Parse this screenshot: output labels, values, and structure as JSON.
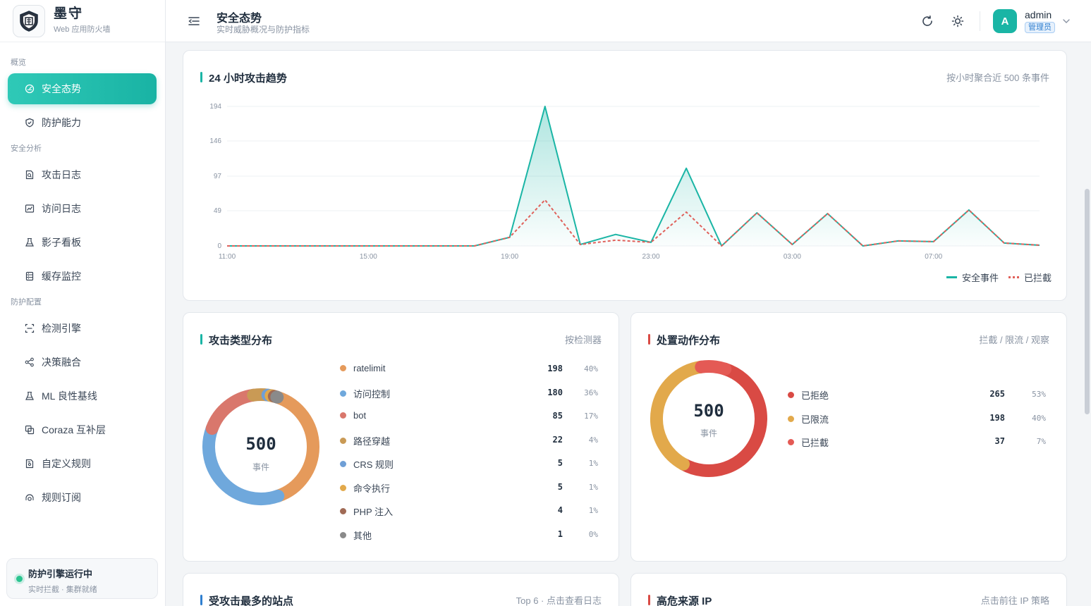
{
  "brand": {
    "title": "墨守",
    "subtitle": "Web 应用防火墙"
  },
  "sidebar": {
    "groups": [
      {
        "label": "概览",
        "items": [
          {
            "label": "安全态势",
            "icon": "dashboard-icon",
            "active": true
          },
          {
            "label": "防护能力",
            "icon": "shield-icon"
          }
        ]
      },
      {
        "label": "安全分析",
        "items": [
          {
            "label": "攻击日志",
            "icon": "file-search-icon"
          },
          {
            "label": "访问日志",
            "icon": "line-chart-icon"
          },
          {
            "label": "影子看板",
            "icon": "flask-icon"
          },
          {
            "label": "缓存监控",
            "icon": "database-icon"
          }
        ]
      },
      {
        "label": "防护配置",
        "items": [
          {
            "label": "检测引擎",
            "icon": "scan-icon"
          },
          {
            "label": "决策融合",
            "icon": "share-nodes-icon"
          },
          {
            "label": "ML 良性基线",
            "icon": "flask-icon"
          },
          {
            "label": "Coraza 互补层",
            "icon": "copy-icon"
          },
          {
            "label": "自定义规则",
            "icon": "file-gear-icon"
          },
          {
            "label": "规则订阅",
            "icon": "subscribe-icon"
          }
        ]
      }
    ],
    "engine": {
      "title": "防护引擎运行中",
      "subtitle": "实时拦截 · 集群就绪"
    }
  },
  "header": {
    "title": "安全态势",
    "subtitle": "实时威胁概况与防护指标",
    "user": {
      "name": "admin",
      "initial": "A",
      "role": "管理员"
    }
  },
  "trend": {
    "title": "24 小时攻击趋势",
    "extra": "按小时聚合近 500 条事件",
    "chart_data": {
      "type": "line",
      "x": [
        "11:00",
        "12:00",
        "13:00",
        "14:00",
        "15:00",
        "16:00",
        "17:00",
        "18:00",
        "19:00",
        "20:00",
        "21:00",
        "22:00",
        "23:00",
        "00:00",
        "01:00",
        "02:00",
        "03:00",
        "04:00",
        "05:00",
        "06:00",
        "07:00",
        "08:00",
        "09:00",
        "10:00"
      ],
      "xticks": [
        "11:00",
        "15:00",
        "19:00",
        "23:00",
        "03:00",
        "07:00"
      ],
      "yticks": [
        0,
        49,
        97,
        146,
        194
      ],
      "ylim": [
        0,
        194
      ],
      "series": [
        {
          "name": "安全事件",
          "color": "#1ab5a5",
          "values": [
            0,
            0,
            0,
            0,
            0,
            0,
            0,
            0,
            12,
            194,
            2,
            16,
            5,
            108,
            0,
            46,
            2,
            45,
            0,
            7,
            6,
            50,
            4,
            1
          ]
        },
        {
          "name": "已拦截",
          "color": "#e0605a",
          "values": [
            0,
            0,
            0,
            0,
            0,
            0,
            0,
            0,
            12,
            64,
            2,
            8,
            5,
            47,
            0,
            46,
            2,
            45,
            0,
            7,
            6,
            50,
            4,
            1
          ]
        }
      ]
    }
  },
  "attack_types": {
    "title": "攻击类型分布",
    "extra": "按检测器",
    "total": "500",
    "total_label": "事件",
    "chart_data": {
      "type": "pie",
      "categories": [
        "ratelimit",
        "访问控制",
        "bot",
        "路径穿越",
        "CRS 规则",
        "命令执行",
        "PHP 注入",
        "其他"
      ],
      "values": [
        198,
        180,
        85,
        22,
        5,
        5,
        4,
        1
      ],
      "percents": [
        "40%",
        "36%",
        "17%",
        "4%",
        "1%",
        "1%",
        "1%",
        "0%"
      ],
      "colors": [
        "#e59a5b",
        "#6fa8dc",
        "#d9776c",
        "#c99a55",
        "#6f9fd6",
        "#e2a94b",
        "#a06a55",
        "#8a8a8a"
      ]
    }
  },
  "actions": {
    "title": "处置动作分布",
    "extra": "拦截 / 限流 / 观察",
    "total": "500",
    "total_label": "事件",
    "chart_data": {
      "type": "pie",
      "categories": [
        "已拒绝",
        "已限流",
        "已拦截"
      ],
      "values": [
        265,
        198,
        37
      ],
      "percents": [
        "53%",
        "40%",
        "7%"
      ],
      "colors": [
        "#d94a44",
        "#e2a94b",
        "#e45a55"
      ]
    }
  },
  "top_sites": {
    "title": "受攻击最多的站点",
    "extra": "Top 6 · 点击查看日志"
  },
  "risky_ips": {
    "title": "高危来源 IP",
    "extra": "点击前往 IP 策略"
  }
}
